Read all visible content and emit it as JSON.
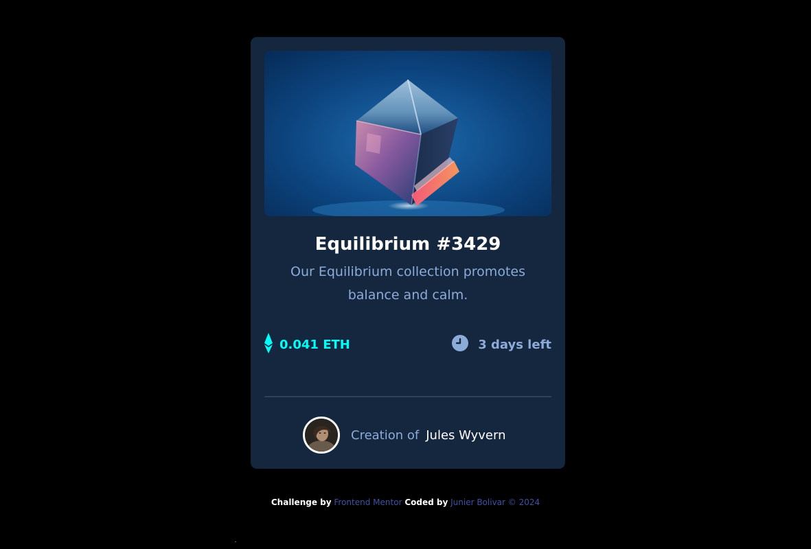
{
  "card": {
    "title": "Equilibrium #3429",
    "description": "Our Equilibrium collection promotes balance and calm.",
    "price": "0.041 ETH",
    "time_left": "3 days left",
    "creator_label": "Creation of",
    "creator_name": "Jules Wyvern",
    "icons": {
      "price": "ethereum-icon",
      "time": "clock-icon",
      "image": "equilibrium-cube-image",
      "avatar": "creator-avatar"
    }
  },
  "footer": {
    "challenge_by": "Challenge by",
    "frontend_mentor": "Frontend Mentor",
    "coded_by": "Coded by",
    "author": "Junier Bolivar © 2024"
  },
  "colors": {
    "background": "#000000",
    "card": "#15263f",
    "accent": "#00fff8",
    "muted": "#8bacd9",
    "divider": "#2e405a",
    "link": "#3e52a3"
  }
}
